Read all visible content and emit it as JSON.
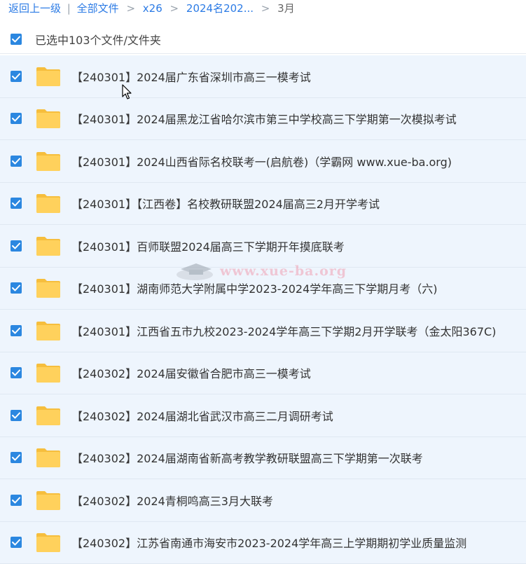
{
  "breadcrumb": {
    "back": "返回上一级",
    "separator": "|",
    "root": "全部文件",
    "crumbs": [
      "x26",
      "2024名202...",
      "3月"
    ],
    "arrow": ">"
  },
  "selection": {
    "label": "已选中103个文件/文件夹"
  },
  "colors": {
    "link": "#2c7be5",
    "checkbox": "#2b87e0",
    "folder": "#ffd15c",
    "row_bg": "#eef5fd"
  },
  "icons": {
    "checkbox": "check-icon",
    "folder": "folder-icon",
    "cursor": "mouse-cursor-icon"
  },
  "watermark": {
    "text": "www.xue-ba.org"
  },
  "files": [
    {
      "name": "【240301】2024届广东省深圳市高三一模考试"
    },
    {
      "name": "【240301】2024届黑龙江省哈尔滨市第三中学校高三下学期第一次模拟考试"
    },
    {
      "name": "【240301】2024山西省际名校联考一(启航卷)（学霸网 www.xue-ba.org)"
    },
    {
      "name": "【240301】【江西卷】名校教研联盟2024届高三2月开学考试"
    },
    {
      "name": "【240301】百师联盟2024届高三下学期开年摸底联考"
    },
    {
      "name": "【240301】湖南师范大学附属中学2023-2024学年高三下学期月考（六)"
    },
    {
      "name": "【240301】江西省五市九校2023-2024学年高三下学期2月开学联考（金太阳367C)"
    },
    {
      "name": "【240302】2024届安徽省合肥市高三一模考试"
    },
    {
      "name": "【240302】2024届湖北省武汉市高三二月调研考试"
    },
    {
      "name": "【240302】2024届湖南省新高考教学教研联盟高三下学期第一次联考"
    },
    {
      "name": "【240302】2024青桐鸣高三3月大联考"
    },
    {
      "name": "【240302】江苏省南通市海安市2023-2024学年高三上学期期初学业质量监测"
    }
  ]
}
